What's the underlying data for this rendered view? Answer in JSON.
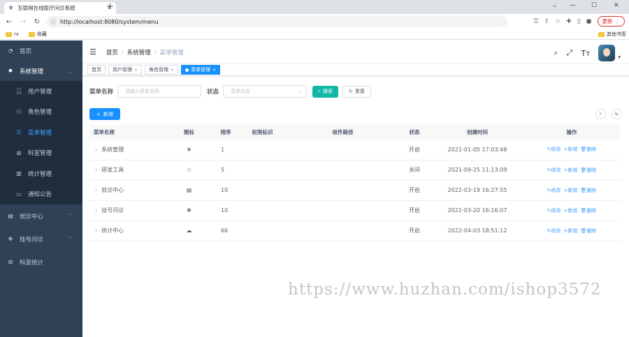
{
  "browser": {
    "tab_title": "互联网在线医疗问诊系统",
    "url": "http://localhost:8080/system/menu",
    "update_label": "更新",
    "bookmarks": [
      "rx",
      "收藏"
    ],
    "bookmarks_right": "其他书签"
  },
  "sidebar": {
    "items": [
      {
        "label": "首页",
        "icon": "dashboard-icon"
      },
      {
        "label": "系统管理",
        "icon": "gear-icon",
        "expanded": true
      },
      {
        "label": "用户管理",
        "icon": "user-icon"
      },
      {
        "label": "角色管理",
        "icon": "peoples-icon"
      },
      {
        "label": "菜单管理",
        "icon": "tree-table-icon",
        "active": true
      },
      {
        "label": "科室管理",
        "icon": "tree-icon"
      },
      {
        "label": "统计管理",
        "icon": "chart-icon"
      },
      {
        "label": "通知公告",
        "icon": "message-icon"
      },
      {
        "label": "就诊中心",
        "icon": "monitor-icon"
      },
      {
        "label": "挂号问诊",
        "icon": "puzzle-icon"
      },
      {
        "label": "科室统计",
        "icon": "tree-icon"
      }
    ]
  },
  "breadcrumb": [
    "首页",
    "系统管理",
    "菜单管理"
  ],
  "tags": [
    "首页",
    "用户管理",
    "角色管理",
    "菜单管理"
  ],
  "search": {
    "name_label": "菜单名称",
    "name_placeholder": "请输入菜单名称",
    "status_label": "状态",
    "status_placeholder": "菜单状态",
    "search_btn": "搜索",
    "reset_btn": "重置",
    "add_btn": "新增"
  },
  "table": {
    "headers": [
      "菜单名称",
      "图标",
      "排序",
      "权限标识",
      "组件路径",
      "状态",
      "创建时间",
      "操作"
    ],
    "rows": [
      {
        "name": "系统管理",
        "icon": "gear-icon",
        "order": "1",
        "perm": "",
        "path": "",
        "status": "开启",
        "time": "2021-01-05 17:03:48"
      },
      {
        "name": "研发工具",
        "icon": "tool-icon",
        "order": "5",
        "perm": "",
        "path": "",
        "status": "关闭",
        "time": "2021-09-25 11:13:09"
      },
      {
        "name": "就诊中心",
        "icon": "monitor-icon",
        "order": "10",
        "perm": "",
        "path": "",
        "status": "开启",
        "time": "2022-03-19 16:27:55"
      },
      {
        "name": "挂号问诊",
        "icon": "puzzle-icon",
        "order": "10",
        "perm": "",
        "path": "",
        "status": "开启",
        "time": "2022-03-20 16:16:07"
      },
      {
        "name": "统计中心",
        "icon": "upload-icon",
        "order": "66",
        "perm": "",
        "path": "",
        "status": "开启",
        "time": "2022-04-03 18:51:12"
      }
    ],
    "ops": [
      "修改",
      "新增",
      "删除"
    ]
  },
  "watermark": "https://www.huzhan.com/ishop3572"
}
